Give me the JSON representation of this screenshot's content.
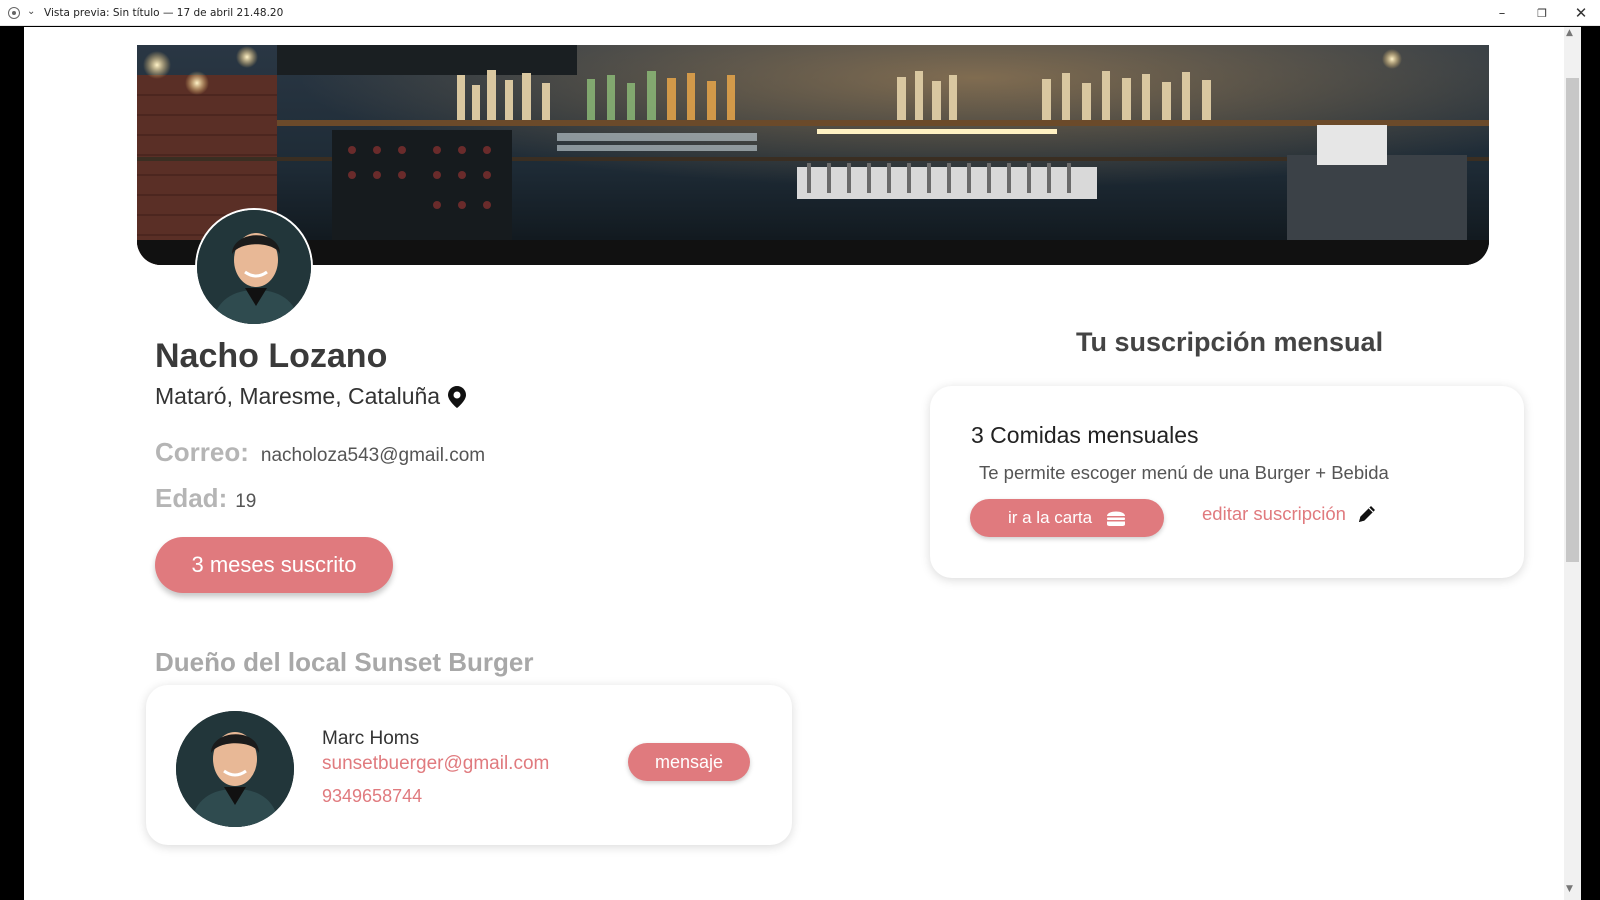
{
  "window": {
    "title": "Vista previa: Sin título — 17 de abril 21.48.20",
    "controls": {
      "minimize": "–",
      "maximize": "❐",
      "close": "✕"
    }
  },
  "banner": {
    "image": "bar-interior-photo"
  },
  "profile": {
    "name": "Nacho Lozano",
    "location": "Mataró, Maresme, Cataluña",
    "location_icon": "location-pin-icon",
    "email_label": "Correo:",
    "email": "nacholoza543@gmail.com",
    "age_label": "Edad:",
    "age": "19",
    "subscription_badge": "3 meses suscrito"
  },
  "owner": {
    "heading": "Dueño del local Sunset Burger",
    "name": "Marc Homs",
    "email": "sunsetbuerger@gmail.com",
    "phone": "9349658744",
    "message_button": "mensaje"
  },
  "subscription": {
    "heading": "Tu suscripción mensual",
    "plan_title": "3 Comidas mensuales",
    "plan_description": "Te permite escoger menú de una Burger  + Bebida",
    "menu_button": "ir a la carta",
    "menu_icon": "burger-icon",
    "edit_link": "editar suscripción",
    "edit_icon": "pencil-icon"
  },
  "colors": {
    "accent": "#e07a7e",
    "heading_gray": "#a8a8a8",
    "text_dark": "#3a3a3a"
  },
  "scroll": {
    "up": "▲",
    "down": "▼"
  }
}
